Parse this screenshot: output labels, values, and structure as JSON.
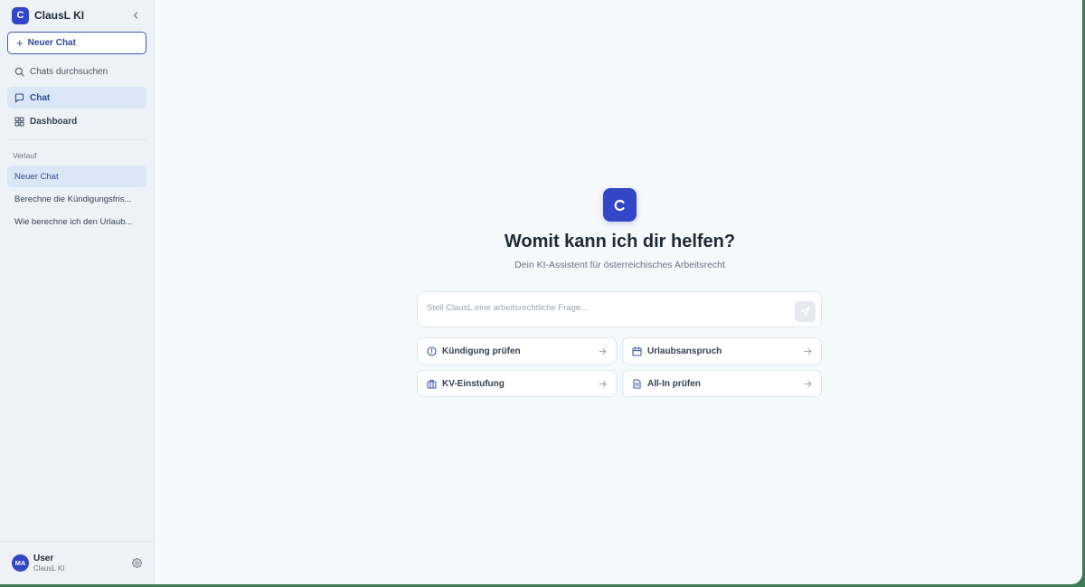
{
  "app": {
    "name": "ClausL KI",
    "logo_letter": "C"
  },
  "sidebar": {
    "new_chat_label": "Neuer Chat",
    "search_label": "Chats durchsuchen",
    "nav": {
      "chat": "Chat",
      "dashboard": "Dashboard"
    },
    "history_label": "Verlauf",
    "history": [
      "Neuer Chat",
      "Berechne die Kündigungsfris...",
      "Wie berechne ich den Urlaub..."
    ]
  },
  "user": {
    "initials": "MA",
    "name": "User",
    "subtitle": "ClausL KI"
  },
  "main": {
    "title": "Womit kann ich dir helfen?",
    "subtitle": "Dein KI-Assistent für österreichisches Arbeitsrecht",
    "prompt_placeholder": "Stell ClausL eine arbeitsrechtliche Frage...",
    "suggestions": [
      {
        "label": "Kündigung prüfen",
        "icon": "info-circle-icon"
      },
      {
        "label": "Urlaubsanspruch",
        "icon": "calendar-icon"
      },
      {
        "label": "KV-Einstufung",
        "icon": "briefcase-icon"
      },
      {
        "label": "All-In prüfen",
        "icon": "document-icon"
      }
    ]
  },
  "colors": {
    "accent": "#3346c7",
    "sidebar_bg": "#eef2f7",
    "main_bg": "#f5f9fa",
    "active_item": "#dbe6f7"
  }
}
